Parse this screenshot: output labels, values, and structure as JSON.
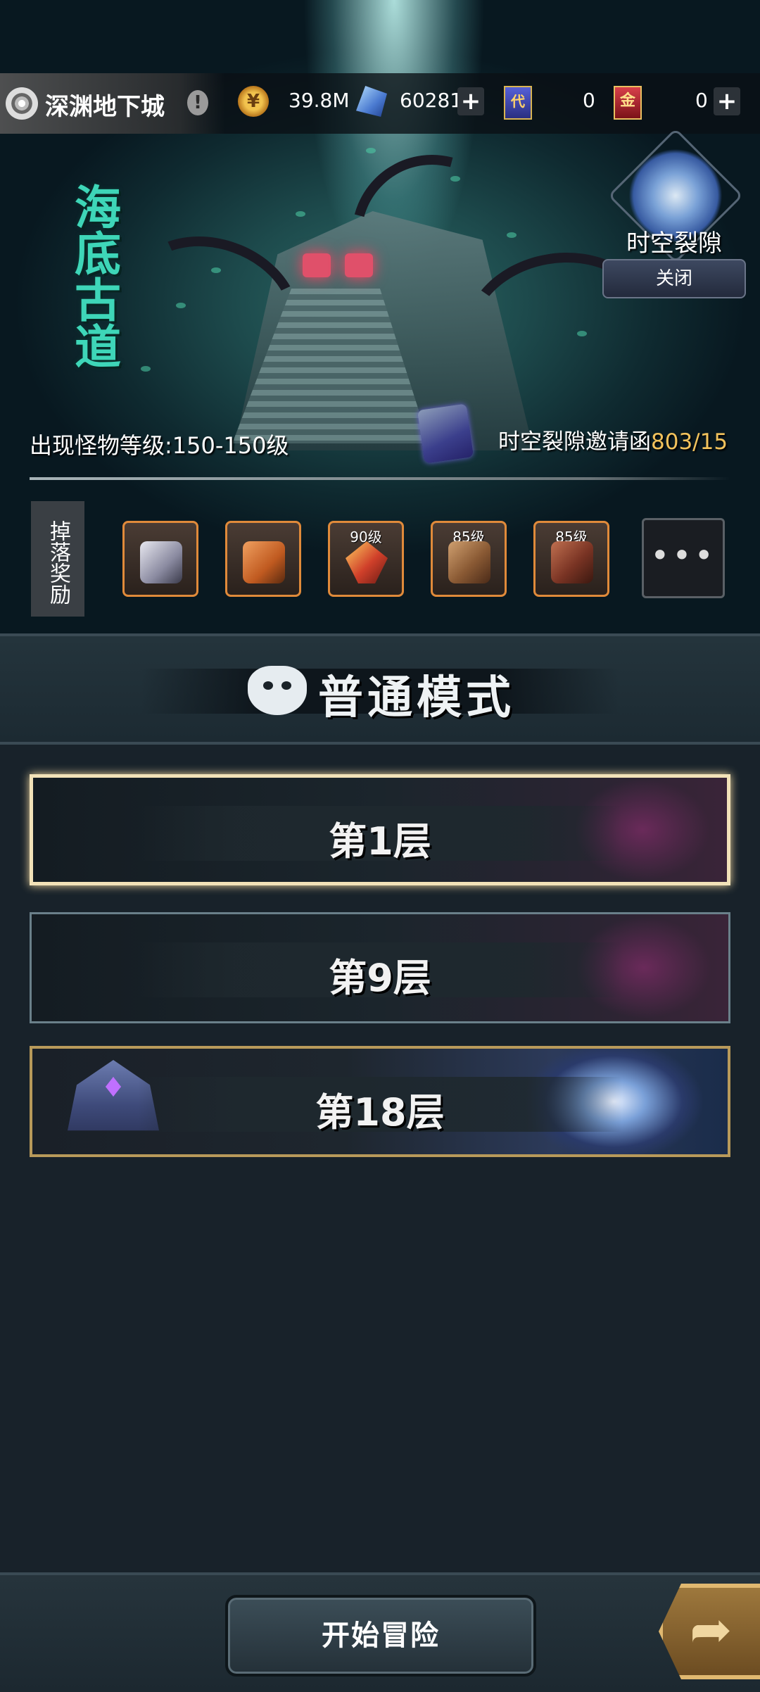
{
  "header": {
    "dungeon_name": "深渊地下城",
    "alert_glyph": "!",
    "resources": [
      {
        "icon": "gold-coin-icon",
        "value": "39.8M"
      },
      {
        "icon": "crystal-icon",
        "value": "60281"
      },
      {
        "icon": "blue-card-icon",
        "value": "0",
        "icon_text": "代"
      },
      {
        "icon": "red-card-icon",
        "value": "0",
        "icon_text": "金"
      }
    ],
    "plus_glyph": "+"
  },
  "scene": {
    "title": "海底古道"
  },
  "rift": {
    "label": "时空裂隙",
    "close_label": "关闭"
  },
  "info": {
    "monster_level": "出现怪物等级:150-150级",
    "invite_label": "时空裂隙邀请函",
    "invite_count": "803/15"
  },
  "drops": {
    "label": "掉落奖励",
    "items": [
      {
        "icon": "silver-beast-icon",
        "tag": ""
      },
      {
        "icon": "orange-dragon-icon",
        "tag": ""
      },
      {
        "icon": "axe-weapon-icon",
        "tag": "90级"
      },
      {
        "icon": "gauntlet-icon",
        "tag": "85级"
      },
      {
        "icon": "greaves-icon",
        "tag": "85级"
      }
    ],
    "more_label": "•••"
  },
  "mode": {
    "title": "普通模式"
  },
  "floors": [
    {
      "label": "第1层",
      "selected": true
    },
    {
      "label": "第9层",
      "selected": false
    },
    {
      "label": "第18层",
      "selected": false
    }
  ],
  "footer": {
    "start_label": "开始冒险",
    "share_glyph": "➦"
  },
  "colors": {
    "accent_gold": "#f2c25c",
    "reward_border": "#e08a3a",
    "title_teal": "#3ed6b8"
  }
}
